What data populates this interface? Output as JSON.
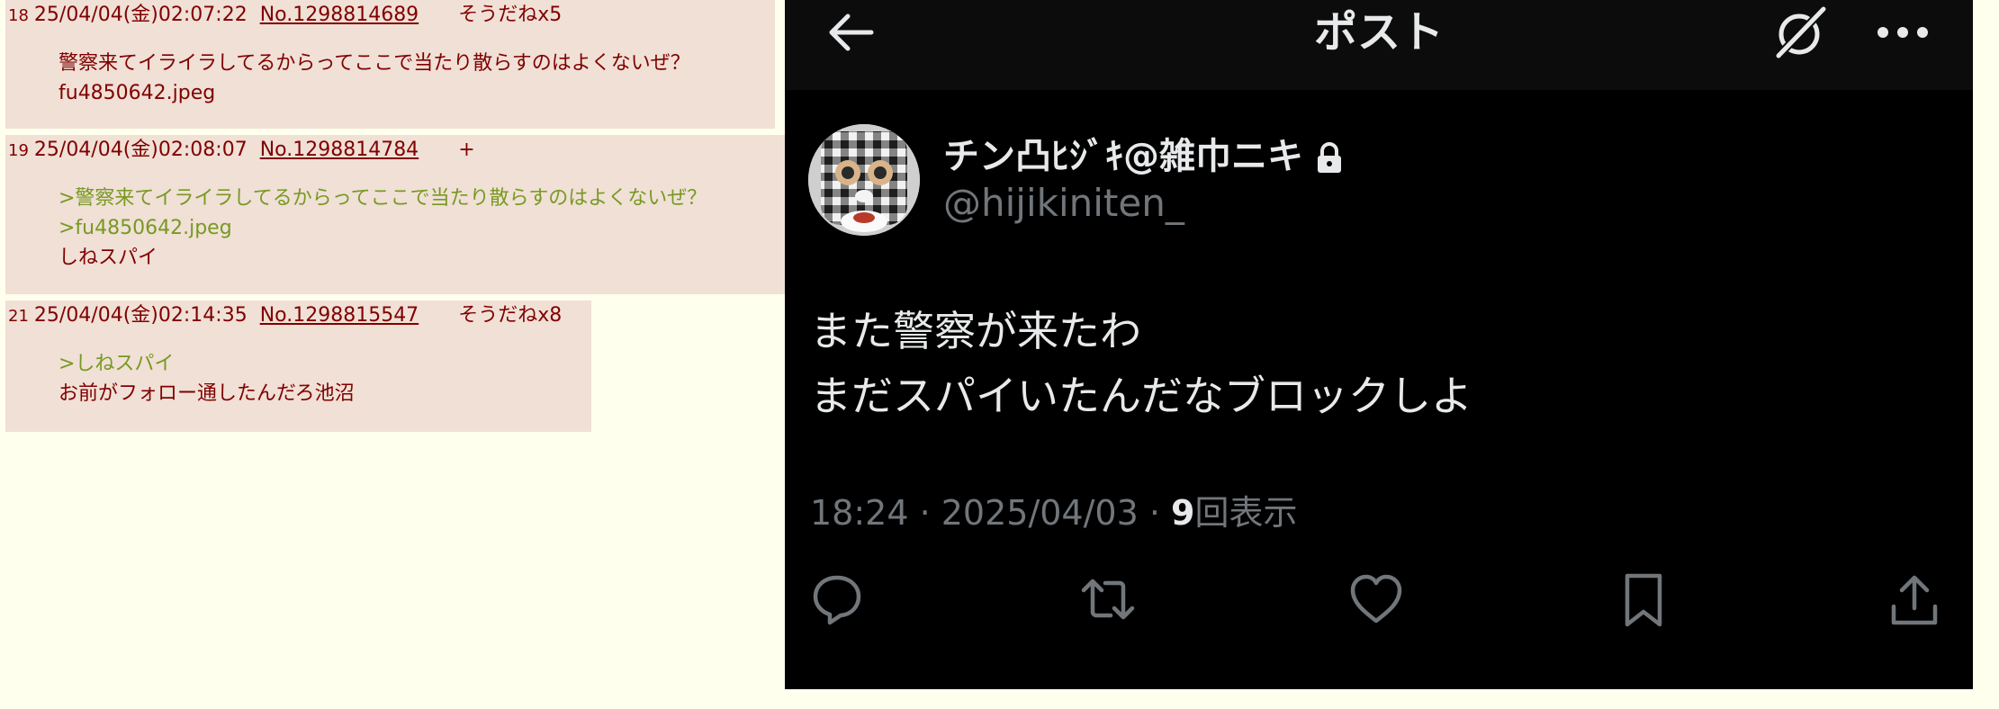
{
  "thread": {
    "posts": [
      {
        "num": "18",
        "date": "25/04/04(金)02:07:22",
        "no": "No.1298814689",
        "sodane": "そうだねx5",
        "lines": [
          {
            "text": "警察来てイライラしてるからってここで当たり散らすのはよくないぜ？",
            "quote": false
          },
          {
            "text": "fu4850642.jpeg",
            "quote": false
          }
        ]
      },
      {
        "num": "19",
        "date": "25/04/04(金)02:08:07",
        "no": "No.1298814784",
        "sodane": "+",
        "lines": [
          {
            "text": ">警察来てイライラしてるからってここで当たり散らすのはよくないぜ？",
            "quote": true
          },
          {
            "text": ">fu4850642.jpeg",
            "quote": true
          },
          {
            "text": "しねスパイ",
            "quote": false
          }
        ]
      },
      {
        "num": "21",
        "date": "25/04/04(金)02:14:35",
        "no": "No.1298815547",
        "sodane": "そうだねx8",
        "lines": [
          {
            "text": ">しねスパイ",
            "quote": true
          },
          {
            "text": "お前がフォロー通したんだろ池沼",
            "quote": false
          }
        ]
      }
    ]
  },
  "x_post": {
    "header_title": "ポスト",
    "display_name": "チン凸ﾋｼﾞｷ@雑巾ニキ",
    "handle": "@hijikiniten_",
    "text_lines": [
      "また警察が来たわ",
      "まだスパイいたんだなブロックしよ"
    ],
    "time": "18:24 · 2025/04/03 · ",
    "views_count": "9",
    "views_label": "回表示",
    "icons": [
      "back-arrow-icon",
      "grok-icon",
      "more-icon",
      "lock-icon",
      "reply-icon",
      "retweet-icon",
      "like-icon",
      "bookmark-icon",
      "share-icon"
    ]
  }
}
